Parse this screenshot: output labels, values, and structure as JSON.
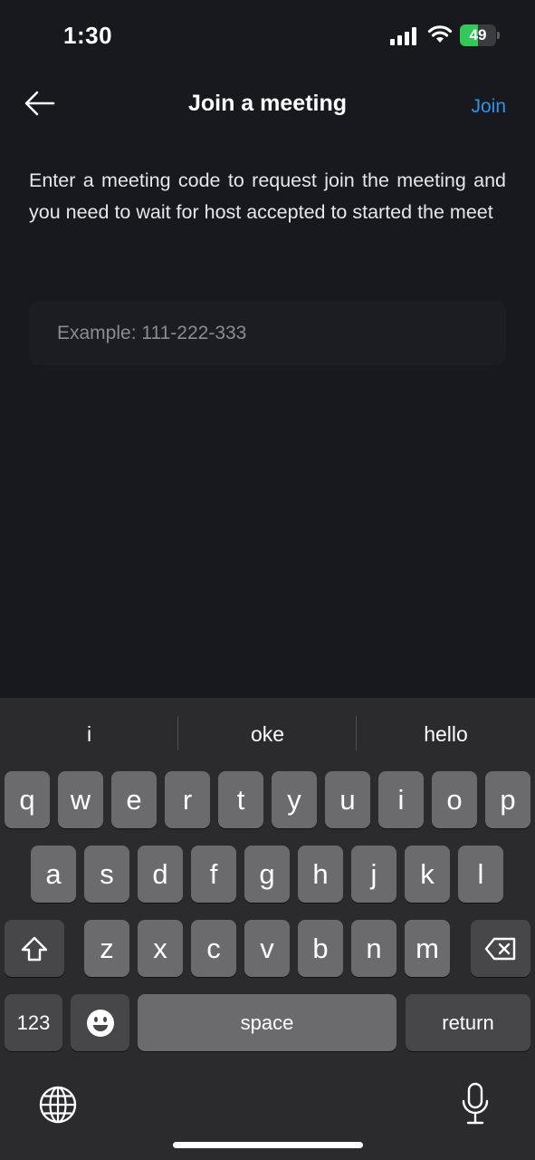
{
  "status_bar": {
    "time": "1:30",
    "battery_percent": "49",
    "battery_level": 0.49,
    "battery_color": "#34c759"
  },
  "header": {
    "back_icon": "arrow-left-icon",
    "title": "Join a meeting",
    "join_label": "Join",
    "accent_color": "#2f93e6"
  },
  "instructions": "Enter a meeting code to request join the meeting and you need to wait for host accepted to started the meet",
  "code_input": {
    "value": "",
    "placeholder": "Example: 111-222-333"
  },
  "keyboard": {
    "suggestions": [
      "i",
      "oke",
      "hello"
    ],
    "row1": [
      "q",
      "w",
      "e",
      "r",
      "t",
      "y",
      "u",
      "i",
      "o",
      "p"
    ],
    "row2": [
      "a",
      "s",
      "d",
      "f",
      "g",
      "h",
      "j",
      "k",
      "l"
    ],
    "row3": [
      "z",
      "x",
      "c",
      "v",
      "b",
      "n",
      "m"
    ],
    "shift_icon": "shift-icon",
    "delete_icon": "backspace-icon",
    "numbers_label": "123",
    "emoji_icon": "emoji-icon",
    "space_label": "space",
    "return_label": "return",
    "globe_icon": "globe-icon",
    "mic_icon": "microphone-icon"
  }
}
